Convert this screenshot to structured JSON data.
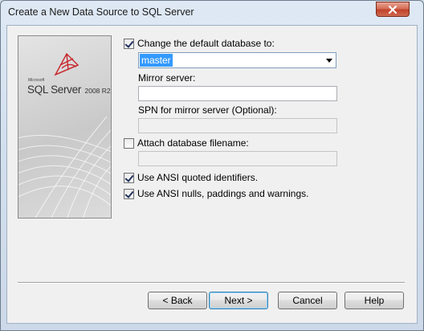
{
  "window": {
    "title": "Create a New Data Source to SQL Server"
  },
  "banner": {
    "brand_small": "Microsoft",
    "brand_name": "SQL Server",
    "brand_version": "2008 R2"
  },
  "options": {
    "change_default_db": {
      "label": "Change the default database to:",
      "checked": true
    },
    "database_select": {
      "value": "master"
    },
    "mirror_server": {
      "label": "Mirror server:",
      "value": ""
    },
    "spn_mirror": {
      "label": "SPN for mirror server (Optional):",
      "value": ""
    },
    "attach_db": {
      "label": "Attach database filename:",
      "checked": false
    },
    "attach_db_path": {
      "value": ""
    },
    "ansi_quoted": {
      "label": "Use ANSI quoted identifiers.",
      "checked": true
    },
    "ansi_nulls": {
      "label": "Use ANSI nulls, paddings and warnings.",
      "checked": true
    }
  },
  "buttons": {
    "back": "< Back",
    "next": "Next >",
    "cancel": "Cancel",
    "help": "Help"
  },
  "colors": {
    "selection": "#3399ff",
    "close_button": "#c9543c"
  }
}
